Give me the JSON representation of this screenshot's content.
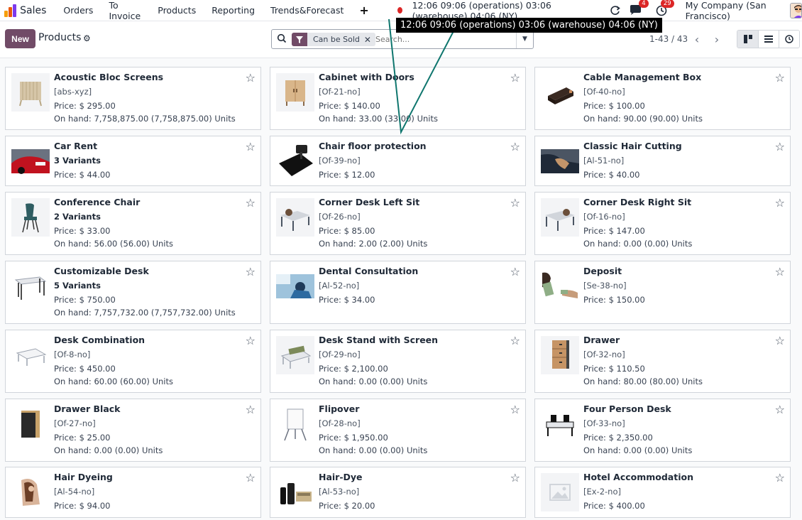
{
  "navbar": {
    "app_name": "Sales",
    "menu": [
      "Orders",
      "To Invoice",
      "Products",
      "Reporting",
      "Trends&Forecast"
    ],
    "clock": "12:06  09:06 (operations)  03:06 (warehouse)  04:06 (NY)",
    "messages_badge": "4",
    "activities_badge": "29",
    "company": "My Company (San Francisco)"
  },
  "tooltip": "12:06 09:06 (operations) 03:06 (warehouse) 04:06 (NY)",
  "control": {
    "new_label": "New",
    "breadcrumb": "Products",
    "facet_label": "Can be Sold",
    "search_placeholder": "Search...",
    "pager": "1-43 / 43"
  },
  "colors": {
    "brand": "#714B67",
    "badge": "#dc2626",
    "pointer_line": "#0f766e"
  },
  "products": [
    {
      "name": "Acoustic Bloc Screens",
      "ref": "[abs-xyz]",
      "price": "Price: $ 295.00",
      "onhand": "On hand: 7,758,875.00 (7,758,875.00) Units",
      "icon": "acoustic-screen-icon"
    },
    {
      "name": "Cabinet with Doors",
      "ref": "[Of-21-no]",
      "price": "Price: $ 140.00",
      "onhand": "On hand: 33.00 (33.00) Units",
      "icon": "cabinet-icon"
    },
    {
      "name": "Cable Management Box",
      "ref": "[Of-40-no]",
      "price": "Price: $ 100.00",
      "onhand": "On hand: 90.00 (90.00) Units",
      "icon": "cable-box-icon"
    },
    {
      "name": "Car Rent",
      "variants": "3 Variants",
      "price": "Price: $ 44.00",
      "icon": "car-icon"
    },
    {
      "name": "Chair floor protection",
      "ref": "[Of-39-no]",
      "price": "Price: $ 12.00",
      "icon": "floor-mat-icon"
    },
    {
      "name": "Classic Hair Cutting",
      "ref": "[Al-51-no]",
      "price": "Price: $ 40.00",
      "icon": "haircut-icon"
    },
    {
      "name": "Conference Chair",
      "variants": "2 Variants",
      "price": "Price: $ 33.00",
      "onhand": "On hand: 56.00 (56.00) Units",
      "icon": "chair-icon"
    },
    {
      "name": "Corner Desk Left Sit",
      "ref": "[Of-26-no]",
      "price": "Price: $ 85.00",
      "onhand": "On hand: 2.00 (2.00) Units",
      "icon": "corner-desk-icon"
    },
    {
      "name": "Corner Desk Right Sit",
      "ref": "[Of-16-no]",
      "price": "Price: $ 147.00",
      "onhand": "On hand: 0.00 (0.00) Units",
      "icon": "corner-desk-icon"
    },
    {
      "name": "Customizable Desk",
      "variants": "5 Variants",
      "price": "Price: $ 750.00",
      "onhand": "On hand: 7,757,732.00 (7,757,732.00) Units",
      "icon": "desk-icon"
    },
    {
      "name": "Dental Consultation",
      "ref": "[Al-52-no]",
      "price": "Price: $ 34.00",
      "icon": "dental-icon"
    },
    {
      "name": "Deposit",
      "ref": "[Se-38-no]",
      "price": "Price: $ 150.00",
      "icon": "cash-icon"
    },
    {
      "name": "Desk Combination",
      "ref": "[Of-8-no]",
      "price": "Price: $ 450.00",
      "onhand": "On hand: 60.00 (60.00) Units",
      "icon": "desk-combination-icon"
    },
    {
      "name": "Desk Stand with Screen",
      "ref": "[Of-29-no]",
      "price": "Price: $ 2,100.00",
      "onhand": "On hand: 0.00 (0.00) Units",
      "icon": "desk-stand-icon"
    },
    {
      "name": "Drawer",
      "ref": "[Of-32-no]",
      "price": "Price: $ 110.50",
      "onhand": "On hand: 80.00 (80.00) Units",
      "icon": "drawer-icon"
    },
    {
      "name": "Drawer Black",
      "ref": "[Of-27-no]",
      "price": "Price: $ 25.00",
      "onhand": "On hand: 0.00 (0.00) Units",
      "icon": "drawer-black-icon"
    },
    {
      "name": "Flipover",
      "ref": "[Of-28-no]",
      "price": "Price: $ 1,950.00",
      "onhand": "On hand: 0.00 (0.00) Units",
      "icon": "flipchart-icon"
    },
    {
      "name": "Four Person Desk",
      "ref": "[Of-33-no]",
      "price": "Price: $ 2,350.00",
      "onhand": "On hand: 0.00 (0.00) Units",
      "icon": "four-person-desk-icon"
    },
    {
      "name": "Hair Dyeing",
      "ref": "[Al-54-no]",
      "price": "Price: $ 94.00",
      "icon": "hair-dye-icon"
    },
    {
      "name": "Hair-Dye",
      "ref": "[Al-53-no]",
      "price": "Price: $ 20.00",
      "icon": "dye-bottles-icon"
    },
    {
      "name": "Hotel Accommodation",
      "ref": "[Ex-2-no]",
      "price": "Price: $ 400.00",
      "icon": "image-placeholder-icon"
    }
  ]
}
